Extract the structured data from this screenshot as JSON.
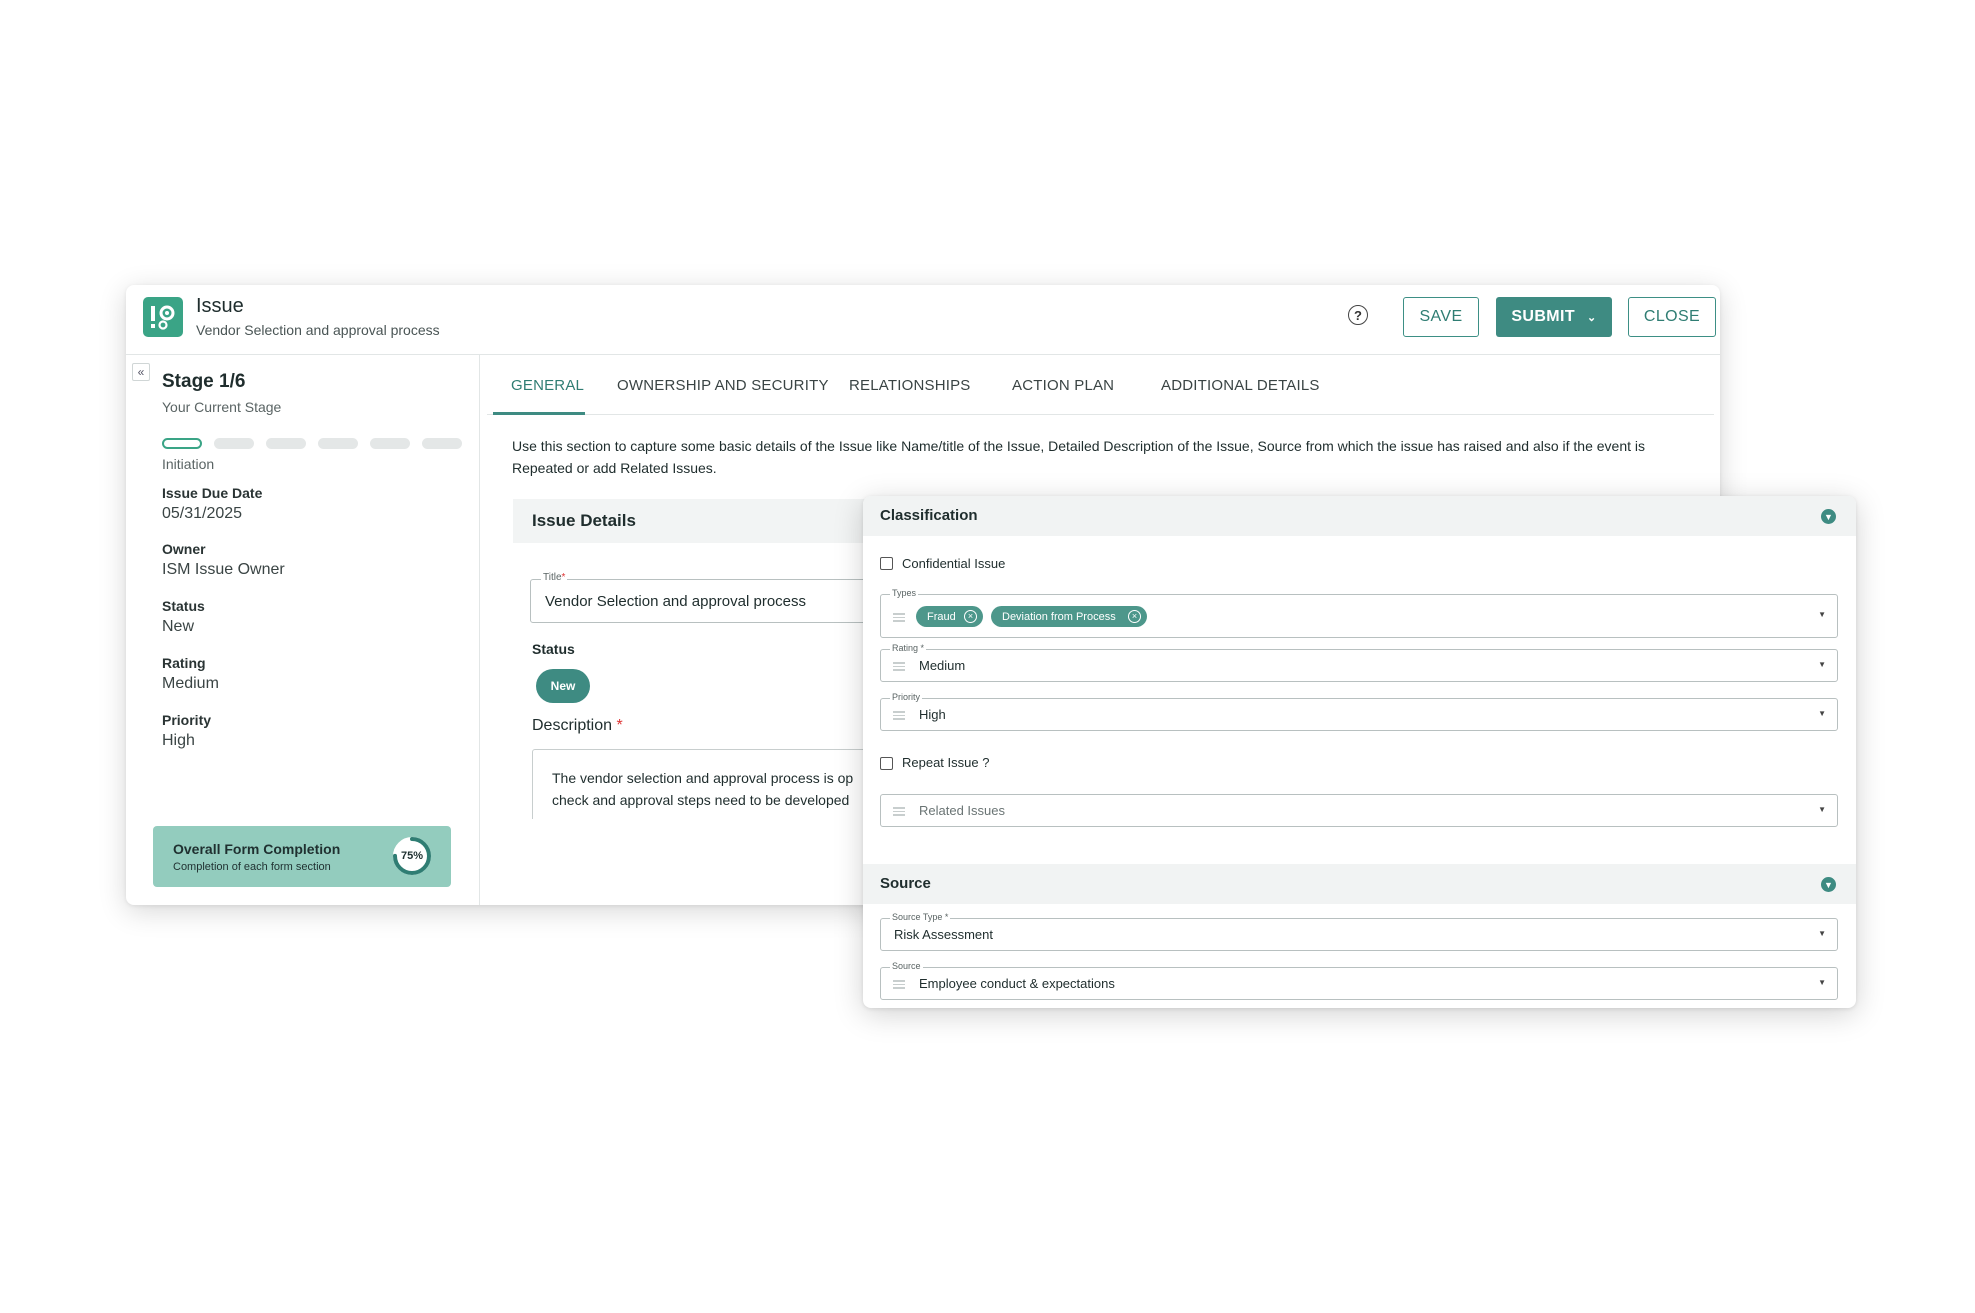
{
  "header": {
    "title": "Issue",
    "subtitle": "Vendor Selection and approval process",
    "app_icon": "issue-gear-icon",
    "help_icon": "help-circle-icon",
    "save_label": "SAVE",
    "submit_label": "SUBMIT",
    "close_label": "CLOSE"
  },
  "sidebar": {
    "collapse_icon": "double-chevron-left-icon",
    "stage_title": "Stage 1/6",
    "stage_subtitle": "Your Current Stage",
    "steps_total": 6,
    "current_step": 1,
    "current_step_label": "Initiation",
    "meta": [
      {
        "label": "Issue Due Date",
        "value": "05/31/2025"
      },
      {
        "label": "Owner",
        "value": "ISM Issue Owner"
      },
      {
        "label": "Status",
        "value": "New"
      },
      {
        "label": "Rating",
        "value": "Medium"
      },
      {
        "label": "Priority",
        "value": "High"
      }
    ],
    "completion": {
      "title": "Overall Form Completion",
      "subtitle": "Completion of each form section",
      "percent_label": "75%",
      "percent": 75
    }
  },
  "tabs": [
    "GENERAL",
    "OWNERSHIP AND SECURITY",
    "RELATIONSHIPS",
    "ACTION PLAN",
    "ADDITIONAL DETAILS"
  ],
  "active_tab": "GENERAL",
  "intro_text": "Use this section to capture some basic details of the Issue like Name/title of the Issue, Detailed Description of the Issue, Source from which the issue has raised and also if the event is Repeated or add Related Issues.",
  "issue_details": {
    "heading": "Issue Details",
    "title_label": "Title",
    "required_mark": "*",
    "title_value": "Vendor Selection and approval process",
    "status_label": "Status",
    "status_value": "New",
    "description_label": "Description",
    "description_line1": "The vendor selection and approval process is op",
    "description_line2": "check and approval steps need to be developed"
  },
  "classification": {
    "heading": "Classification",
    "confidential_label": "Confidential Issue",
    "confidential_checked": false,
    "types_label": "Types",
    "types": [
      "Fraud",
      "Deviation from Process"
    ],
    "rating_label": "Rating *",
    "rating_value": "Medium",
    "priority_label": "Priority",
    "priority_value": "High",
    "repeat_label": "Repeat Issue ?",
    "repeat_checked": false,
    "related_placeholder": "Related Issues"
  },
  "source": {
    "heading": "Source",
    "source_type_label": "Source Type *",
    "source_type_value": "Risk Assessment",
    "source_label": "Source",
    "source_value": "Employee conduct & expectations"
  },
  "colors": {
    "accent": "#3e8b82",
    "icon_green": "#3aa486",
    "completion_bg": "#93ccbe",
    "required": "#dd3333"
  }
}
